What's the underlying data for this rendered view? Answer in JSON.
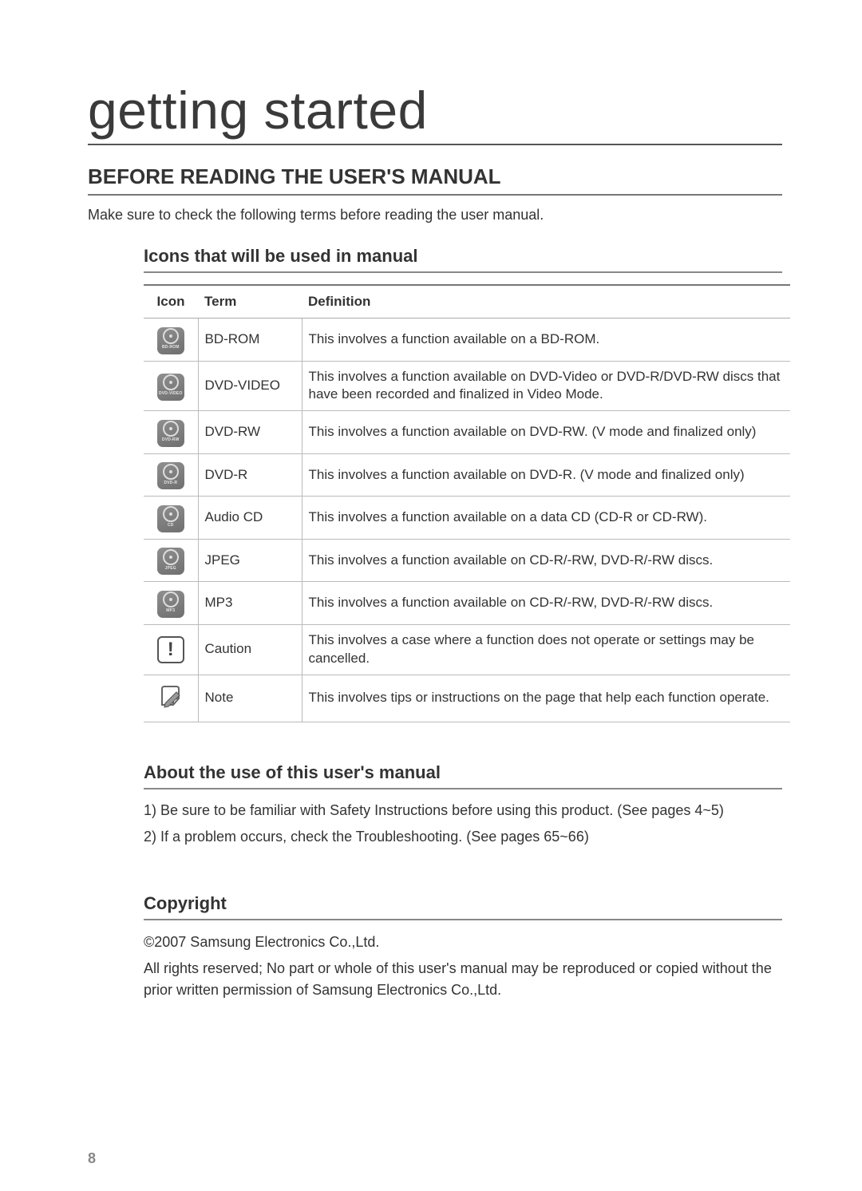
{
  "page": {
    "main_title": "getting started",
    "section_title": "BEFORE READING THE USER'S MANUAL",
    "intro": "Make sure to check the following terms before reading the user manual.",
    "page_number": "8"
  },
  "icons_section": {
    "heading": "Icons that will be used in manual",
    "headers": {
      "icon": "Icon",
      "term": "Term",
      "definition": "Definition"
    },
    "rows": [
      {
        "icon_label": "BD-ROM",
        "term": "BD-ROM",
        "definition": "This involves a function available on a BD-ROM."
      },
      {
        "icon_label": "DVD-VIDEO",
        "term": "DVD-VIDEO",
        "definition": "This involves a function available on DVD-Video or DVD-R/DVD-RW discs that have been recorded and finalized in Video Mode."
      },
      {
        "icon_label": "DVD-RW",
        "term": "DVD-RW",
        "definition": "This involves a function available on DVD-RW. (V mode and finalized only)"
      },
      {
        "icon_label": "DVD-R",
        "term": "DVD-R",
        "definition": "This involves a function available on DVD-R. (V mode and finalized only)"
      },
      {
        "icon_label": "CD",
        "term": "Audio CD",
        "definition": "This involves a function available on a data CD (CD-R or CD-RW)."
      },
      {
        "icon_label": "JPEG",
        "term": "JPEG",
        "definition": "This involves a function available on CD-R/-RW, DVD-R/-RW discs."
      },
      {
        "icon_label": "MP3",
        "term": "MP3",
        "definition": "This involves a function available on CD-R/-RW, DVD-R/-RW discs."
      },
      {
        "icon_label": "!",
        "term": "Caution",
        "definition": "This involves a case where a function does not operate or settings may be cancelled."
      },
      {
        "icon_label": "✎",
        "term": "Note",
        "definition": "This involves tips or instructions on the page that help each function operate."
      }
    ]
  },
  "about_section": {
    "heading": "About the use of this user's manual",
    "items": [
      "1)  Be sure to be familiar with Safety Instructions before using this product. (See pages 4~5)",
      "2)  If a problem occurs, check the Troubleshooting. (See pages 65~66)"
    ]
  },
  "copyright_section": {
    "heading": "Copyright",
    "line1": "©2007 Samsung Electronics Co.,Ltd.",
    "line2": "All rights reserved; No part or whole of this user's manual may be reproduced or copied without the prior written permission of Samsung Electronics Co.,Ltd."
  }
}
